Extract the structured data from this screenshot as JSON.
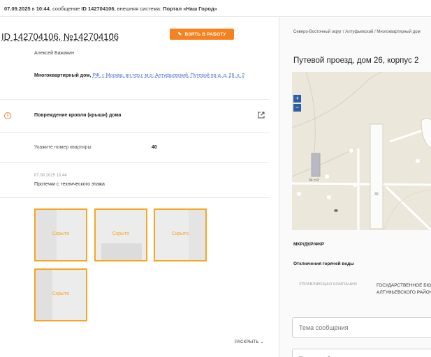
{
  "topbar": {
    "date": "07.09.2025",
    "in_word": "в",
    "time": "10:44",
    "msg_prefix": ", сообщение ",
    "msg_id": "ID 142704106",
    "system_prefix": ", внешняя система: ",
    "system": "Портал «Наш Город»"
  },
  "ticket": {
    "title": "ID 142704106, №142704106",
    "take_button": "ВЗЯТЬ В РАБОТУ",
    "author": "Алексей Бажакин",
    "addr_type": "Многоквартирный дом,",
    "addr_link": "РФ, г. Москва, вн.тер.г. м.о. Алтуфьевский, Путевой пр-д, д. 26, к. 2",
    "problem": "Повреждение кровли (крыши) дома",
    "apt_label": "Укажите номер квартиры:",
    "apt_value": "40",
    "date": "07.09.2025 10:44",
    "description": "Протечки с технического этажа",
    "photo_label": "Скрыто",
    "expand_label": "РАСКРЫТЬ"
  },
  "side": {
    "breadcrumb": "Северо-Восточный округ / Алтуфьевский / Многоквартирный дом",
    "address_title": "Путевой проезд, дом 26, корпус 2",
    "zoom_in": "+",
    "zoom_out": "−",
    "map_labels": {
      "b1": "34 ст2",
      "b2": "30",
      "p": "P"
    },
    "section1": "МКР/ДКР/ФКР",
    "section2": "Отключения горячей воды",
    "uk_label": "УПРАВЛЯЮЩАЯ КОМПАНИЯ",
    "uk_value_1": "ГОСУДАРСТВЕННОЕ БЮДЖЕТНОЕ",
    "uk_value_2": "АЛТУФЬЕВСКОГО РАЙОНА",
    "subject_placeholder": "Тема сообщения",
    "message_placeholder": "Текст сообщения"
  },
  "colors": {
    "accent": "#f5821f",
    "photo_border": "#f5a623",
    "link": "#4a6fd6",
    "zoom": "#2a5fa8"
  }
}
